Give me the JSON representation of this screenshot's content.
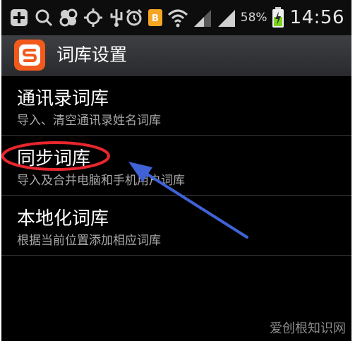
{
  "status_bar": {
    "battery_percent": "58%",
    "time": "14:56",
    "icons": [
      "plus-icon",
      "search-icon",
      "app-icon",
      "sync-icon",
      "usb-icon",
      "alarm-icon",
      "notification-icon",
      "wifi-icon",
      "signal-icon",
      "signal-icon",
      "battery-charging-icon"
    ]
  },
  "action_bar": {
    "title": "词库设置",
    "logo_icon": "sogou-s-icon"
  },
  "list": {
    "items": [
      {
        "title": "通讯录词库",
        "subtitle": "导入、清空通讯录姓名词库"
      },
      {
        "title": "同步词库",
        "subtitle": "导入及合并电脑和手机用户词库"
      },
      {
        "title": "本地化词库",
        "subtitle": "根据当前位置添加相应词库"
      }
    ]
  },
  "annotation": {
    "ellipse_color": "#e8262d",
    "arrow_color": "#3f63d6"
  },
  "watermark": "爱创根知识网",
  "colors": {
    "background": "#000000",
    "action_bar": "#333438",
    "brand": "#f25a1c"
  }
}
